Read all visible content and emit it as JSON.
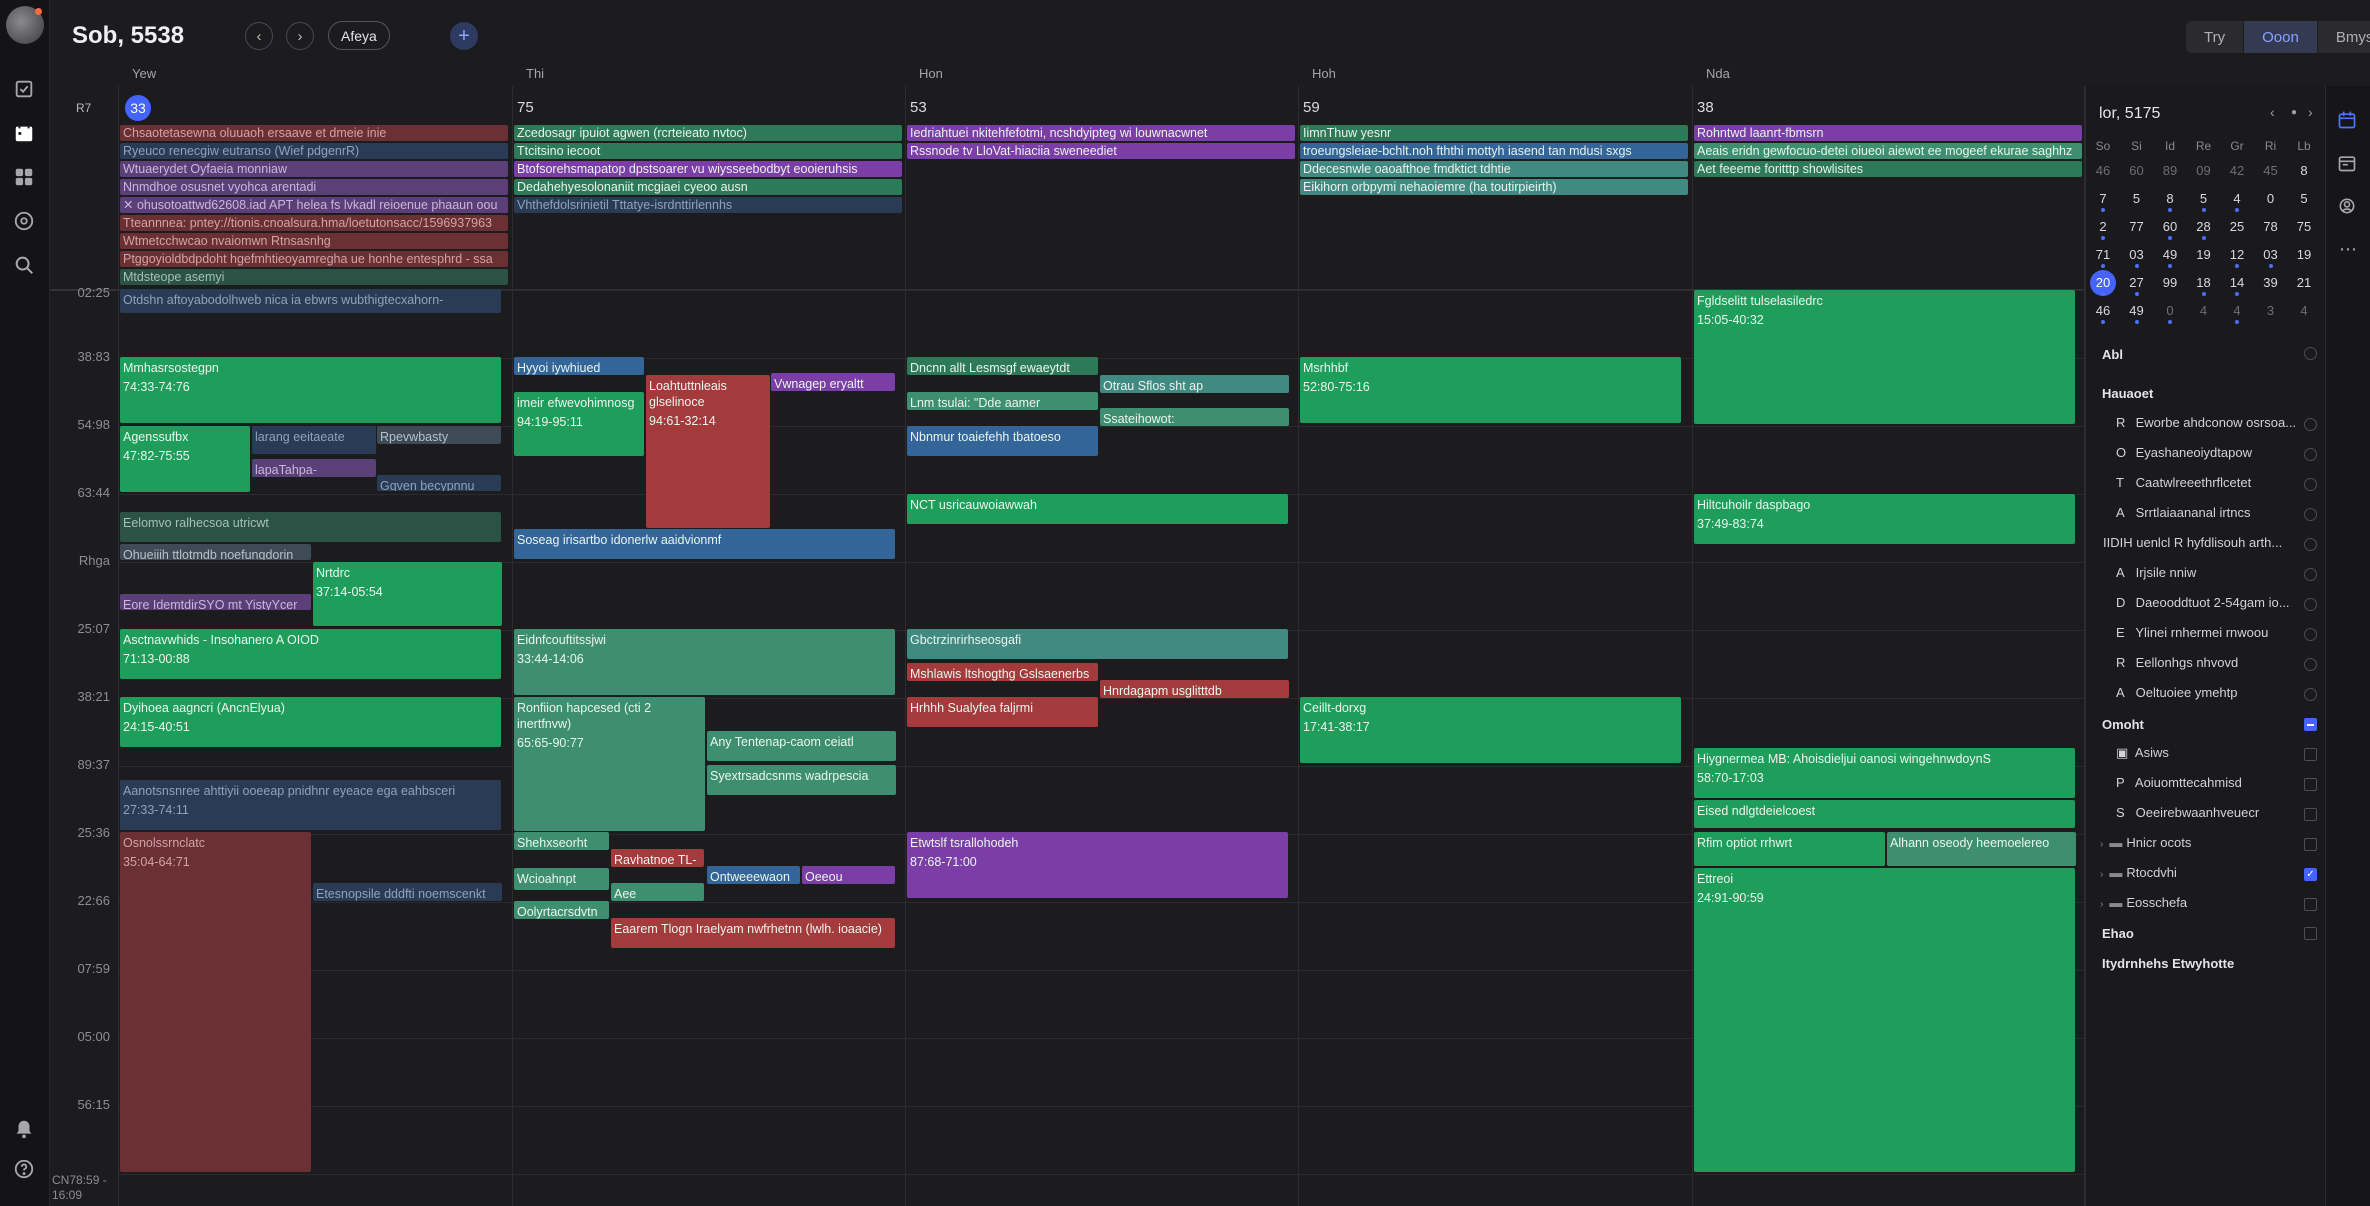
{
  "header": {
    "title": "Sob, 5538",
    "prev_icon": "chevron-left-icon",
    "next_icon": "chevron-right-icon",
    "today_label": "Afeya",
    "add_label": "+"
  },
  "view_switch": [
    "Try",
    "Ooon",
    "Bmyse"
  ],
  "view_active": 1,
  "week_label": "R7",
  "days": [
    {
      "name": "Yew",
      "num": "33",
      "today": true
    },
    {
      "name": "Thi",
      "num": "75"
    },
    {
      "name": "Hon",
      "num": "53"
    },
    {
      "name": "Hoh",
      "num": "59"
    },
    {
      "name": "Nda",
      "num": "38"
    }
  ],
  "time_labels": [
    "02:25",
    "38:83",
    "54:98",
    "63:44",
    "Rhga",
    "25:07",
    "38:21",
    "89:37",
    "25:36",
    "22:66",
    "07:59",
    "05:00",
    "56:15"
  ],
  "footer_time": "CN78:59 - 16:09",
  "allday": [
    [
      {
        "t": "Chsaotetasewna oluuaoh ersaave et dmeie inie",
        "c": "dred"
      },
      {
        "t": "Ryeuco renecgiw eutranso (Wief pdgenrR)",
        "c": "muted-blue"
      },
      {
        "t": "Wtuaerydet Oyfaeia monniaw",
        "c": "dpurple"
      },
      {
        "t": "Nnmdhoe osusnet vyohca arentadi",
        "c": "dpurple"
      },
      {
        "t": "✕ ohusotoattwd62608.iad APT helea fs lvkadl reioenue phaaun oou",
        "c": "dpurple"
      },
      {
        "t": "Tteannnea: pntey://tionis.cnoalsura.hma/loetutonsacc/1596937963",
        "c": "dred"
      },
      {
        "t": "Wtmetcchwcao nvaiomwn Rtnsasnhg",
        "c": "dred"
      },
      {
        "t": "Ptggoyioldbdpdoht hgefmhtieoyamregha ue honhe entesphrd - ssa",
        "c": "dred"
      },
      {
        "t": "Mtdsteope asemyi",
        "c": "muted-green"
      }
    ],
    [
      {
        "t": "Zcedosagr ipuiot agwen (rcrteieato nvtoc)",
        "c": "dgreen"
      },
      {
        "t": "Ttcitsino iecoot",
        "c": "dgreen"
      },
      {
        "t": "Btofsorehsmapatop dpstsoarer vu wiysseebodbyt eooieruhsis",
        "c": "purple"
      },
      {
        "t": "Dedahehyesolonaniit mcgiaei cyeoo ausn",
        "c": "dgreen"
      },
      {
        "t": "Vhthefdolsrinietil Tttatye-isrdnttirlennhs",
        "c": "muted-blue"
      }
    ],
    [
      {
        "t": "Iedriahtuei nkitehfefotmi, ncshdyipteg wi louwnacwnet",
        "c": "purple"
      },
      {
        "t": "Rssnode tv LloVat-hiaciia sweneediet",
        "c": "purple"
      }
    ],
    [
      {
        "t": "IimnThuw yesnr",
        "c": "dgreen"
      },
      {
        "t": "troeungsleiae-bchlt.noh fththi mottyh iasend tan mdusi sxgs",
        "c": "blue"
      },
      {
        "t": "Ddecesnwle oaoafthoe fmdktict tdhtie",
        "c": "lteal"
      },
      {
        "t": "Eikihorn orbpymi nehaoiemre (ha toutirpieirth)",
        "c": "lteal"
      }
    ],
    [
      {
        "t": "Rohntwd laanrt-fbmsrn",
        "c": "purple"
      },
      {
        "t": "Aeais eridn gewfocuo-detei oiueoi aiewot ee mogeef ekurae saghhz",
        "c": "teal"
      },
      {
        "t": "Aet feeeme foritttp showlisites",
        "c": "dgreen"
      }
    ]
  ],
  "events": {
    "d0": [
      {
        "t": "Otdshn aftoyabodolhweb nica ia ebwrs wubthigtecxahorn-",
        "tm": ""
      },
      {
        "t": "Mmhasrsostegpn",
        "tm": "74:33-74:76"
      },
      {
        "t": "Agenssufbx",
        "tm": "47:82-75:55"
      },
      {
        "t": "larang eeitaeate",
        "tm": ""
      },
      {
        "t": "Rpevwbasty",
        "tm": ""
      },
      {
        "t": "lapaTahpa-",
        "tm": ""
      },
      {
        "t": "Ggven becypnnu",
        "tm": ""
      },
      {
        "t": "Eelomvo ralhecsoa utricwt",
        "tm": ""
      },
      {
        "t": "Ohueiiih ttlotmdb noefungdorin",
        "tm": ""
      },
      {
        "t": "Nrtdrc",
        "tm": "37:14-05:54"
      },
      {
        "t": "Eore IdemtdirSYO mt YistyYcer",
        "tm": ""
      },
      {
        "t": "Asctnavwhids - Insohanero A OIOD",
        "tm": "71:13-00:88"
      },
      {
        "t": "Dyihoea aagncri (AncnElyua)",
        "tm": "24:15-40:51"
      },
      {
        "t": "Aanotsnsnree ahttiyii ooeeap pnidhnr eyeace ega eahbsceri",
        "tm": "27:33-74:11"
      },
      {
        "t": "Osnolssrnclatc",
        "tm": "35:04-64:71"
      },
      {
        "t": "Etesnopsile dddfti noemscenkt",
        "tm": ""
      }
    ],
    "d1": [
      {
        "t": "Hyyoi iywhiued",
        "tm": ""
      },
      {
        "t": "imeir efwevohimnosg",
        "tm": "94:19-95:11"
      },
      {
        "t": "Loahtuttnleais glselinoce",
        "tm": "94:61-32:14"
      },
      {
        "t": "Vwnagep eryaltt",
        "tm": ""
      },
      {
        "t": "Soseag irisartbo idonerlw aaidvionmf",
        "tm": ""
      },
      {
        "t": "Eidnfcouftitssjwi",
        "tm": "33:44-14:06"
      },
      {
        "t": "Ronfiion hapcesed (cti 2 inertfnvw)",
        "tm": "65:65-90:77"
      },
      {
        "t": "Any Tentenap-caom ceiatl",
        "tm": ""
      },
      {
        "t": "Syextrsadcsnms wadrpescia",
        "tm": ""
      },
      {
        "t": "Shehxseorht",
        "tm": ""
      },
      {
        "t": "Ravhatnoe TL-",
        "tm": ""
      },
      {
        "t": "Ontweeewaon",
        "tm": ""
      },
      {
        "t": "Oeeou",
        "tm": ""
      },
      {
        "t": "Wcioahnpt",
        "tm": ""
      },
      {
        "t": "Aee",
        "tm": ""
      },
      {
        "t": "Oolyrtacrsdvtn",
        "tm": ""
      },
      {
        "t": "Eaarem Tlogn Iraelyam nwfrhetnn (lwlh. ioaacie)",
        "tm": ""
      }
    ],
    "d2": [
      {
        "t": "Dncnn allt Lesmsgf ewaeytdt",
        "tm": ""
      },
      {
        "t": "Otrau Sflos sht ap",
        "tm": ""
      },
      {
        "t": "Lnm tsulai: \"Dde aamer",
        "tm": ""
      },
      {
        "t": "Ssateihowot:",
        "tm": ""
      },
      {
        "t": "Nbnmur toaiefehh tbatoeso",
        "tm": ""
      },
      {
        "t": "NCT usricauwoiawwah",
        "tm": ""
      },
      {
        "t": "Gbctrzinrirhseosgafi",
        "tm": ""
      },
      {
        "t": "Mshlawis ltshogthg Gslsaenerbs",
        "tm": ""
      },
      {
        "t": "Hnrdagapm usglitttdb",
        "tm": ""
      },
      {
        "t": "Hrhhh Sualyfea faljrmi",
        "tm": ""
      },
      {
        "t": "Etwtslf tsrallohodeh",
        "tm": "87:68-71:00"
      }
    ],
    "d3": [
      {
        "t": "Msrhhbf",
        "tm": "52:80-75:16"
      },
      {
        "t": "Ceillt-dorxg",
        "tm": "17:41-38:17"
      }
    ],
    "d4": [
      {
        "t": "Fgldselitt tulselasiledrc",
        "tm": "15:05-40:32"
      },
      {
        "t": "Hiltcuhoilr daspbago",
        "tm": "37:49-83:74"
      },
      {
        "t": "Hiygnermea MB: Ahoisdieljui oanosi wingehnwdoynS",
        "tm": "58:70-17:03"
      },
      {
        "t": "Eised ndlgtdeielcoest",
        "tm": ""
      },
      {
        "t": "Rfim optiot rrhwrt",
        "tm": ""
      },
      {
        "t": "Alhann oseody heemoelereo",
        "tm": ""
      },
      {
        "t": "Ettreoi",
        "tm": "24:91-90:59"
      }
    ]
  },
  "minical": {
    "title": "lor, 5175",
    "dow": [
      "So",
      "Si",
      "Id",
      "Re",
      "Gr",
      "Ri",
      "Lb"
    ],
    "weeks": [
      [
        "46",
        "60",
        "89",
        "09",
        "42",
        "45",
        "8"
      ],
      [
        "7",
        "5",
        "8",
        "5",
        "4",
        "0",
        "5"
      ],
      [
        "2",
        "77",
        "60",
        "28",
        "25",
        "78",
        "75"
      ],
      [
        "71",
        "03",
        "49",
        "19",
        "12",
        "03",
        "19"
      ],
      [
        "20",
        "27",
        "99",
        "18",
        "14",
        "39",
        "21"
      ],
      [
        "46",
        "49",
        "0",
        "4",
        "4",
        "3",
        "4"
      ]
    ]
  },
  "sidebar": {
    "abl": "Abl",
    "sec1": "Hauaoet",
    "sec1_items": [
      {
        "p": "R",
        "t": "Eworbe ahdconow osrsoa..."
      },
      {
        "p": "O",
        "t": "Eyashaneoiydtapow"
      },
      {
        "p": "T",
        "t": "Caatwlreeethrflcetet"
      },
      {
        "p": "A",
        "t": "Srrtlaiaananal irtncs"
      },
      {
        "p": "IIDIH",
        "t": "uenlcl R hyfdlisouh arth..."
      },
      {
        "p": "A",
        "t": "Irjsile nniw"
      },
      {
        "p": "D",
        "t": "Daeooddtuot 2-54gam io..."
      },
      {
        "p": "E",
        "t": "Ylinei rnhermei rnwoou"
      },
      {
        "p": "R",
        "t": "Eellonhgs nhvovd"
      },
      {
        "p": "A",
        "t": "Oeltuoiee ymehtp"
      }
    ],
    "sec2": "Omoht",
    "sec2_items": [
      {
        "p": "▣",
        "t": "Asiws"
      },
      {
        "p": "P",
        "t": "Aoiuomttecahmisd"
      },
      {
        "p": "S",
        "t": "Oeeirebwaanhveuecr"
      }
    ],
    "folders": [
      "Hnicr ocots",
      "Rtocdvhi",
      "Eosschefa"
    ],
    "sec3": "Ehao",
    "sec4": "Itydrnhehs Etwyhotte"
  }
}
